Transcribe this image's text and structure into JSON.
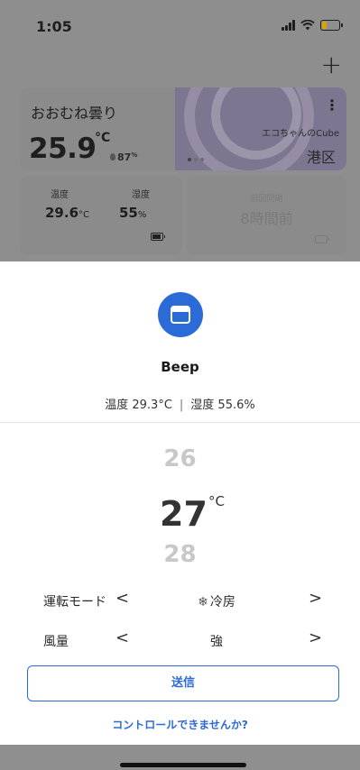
{
  "status_bar": {
    "time": "1:05"
  },
  "header": {
    "add_label": "+"
  },
  "weather_card": {
    "condition": "おおむね曇り",
    "temperature": "25.9",
    "temperature_unit": "°C",
    "humidity": "87",
    "humidity_unit": "%",
    "device_name": "エコちゃんのCube",
    "area": "港区",
    "menu_label": "⋮"
  },
  "sensor_card": {
    "temp_label": "温度",
    "temp_value": "29.6",
    "temp_unit": "°C",
    "humidity_label": "湿度",
    "humidity_value": "55",
    "humidity_unit": "%"
  },
  "remote_card": {
    "label": "前回同期",
    "value": "8時間前"
  },
  "sheet": {
    "device_name": "Beep",
    "room_temp": "温度 29.3°C",
    "separator": "|",
    "room_humidity": "湿度 55.6%",
    "temp_prev": "26",
    "temp_current": "27",
    "temp_unit": "°C",
    "temp_next": "28",
    "mode_label": "運転モード",
    "mode_value": "冷房",
    "fan_label": "風量",
    "fan_value": "強",
    "prev_arrow": "<",
    "next_arrow": ">",
    "send_label": "送信",
    "help_link": "コントロールできませんか?"
  },
  "colors": {
    "accent": "#2b6bd8",
    "overlay": "#8e8e8e"
  }
}
